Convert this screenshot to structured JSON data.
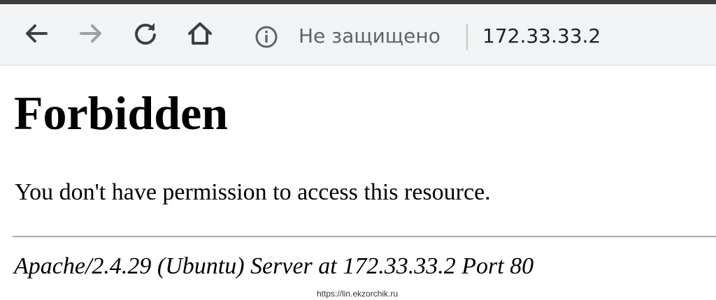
{
  "toolbar": {
    "back_icon": "arrow-left-icon",
    "forward_icon": "arrow-right-icon",
    "reload_icon": "reload-icon",
    "home_icon": "home-icon",
    "info_icon": "info-circle-icon",
    "security_label": "Не защищено",
    "url": "172.33.33.2",
    "forward_enabled": false
  },
  "page": {
    "title": "Forbidden",
    "message": "You don't have permission to access this resource.",
    "signature": "Apache/2.4.29 (Ubuntu) Server at 172.33.33.2 Port 80"
  },
  "watermark": "https://lin.ekzorchik.ru",
  "colors": {
    "toolbar_bg": "#f1f3f4",
    "icon_active": "#3c4043",
    "icon_disabled": "#9aa0a6"
  }
}
